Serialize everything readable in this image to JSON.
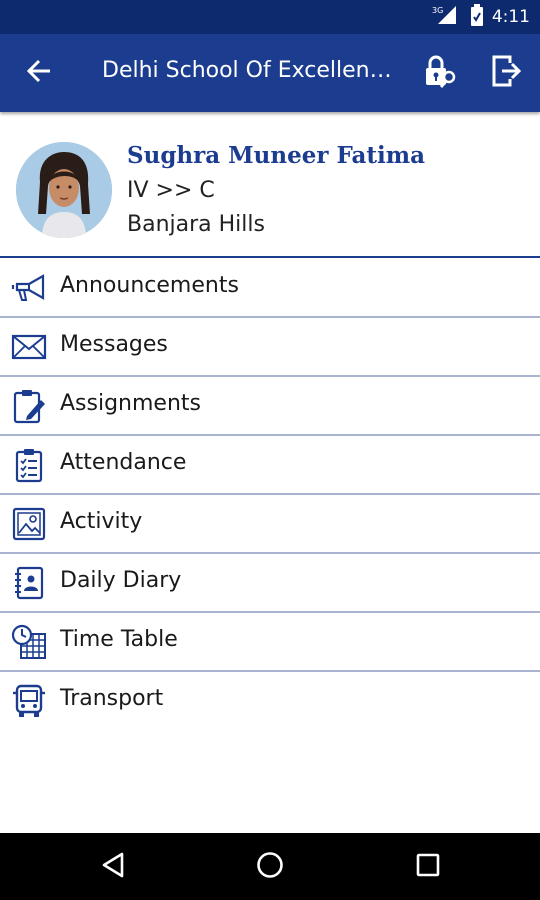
{
  "status_bar": {
    "network_label": "3G",
    "time": "4:11",
    "icons": [
      "signal-icon",
      "battery-icon"
    ]
  },
  "app_bar": {
    "title": "Delhi School Of Excellence",
    "back_icon": "back-arrow-icon",
    "lock_icon": "lock-key-icon",
    "logout_icon": "logout-icon",
    "background_color": "#1c3d8f"
  },
  "profile": {
    "name": "Sughra Muneer Fatima",
    "class_section": "IV >> C",
    "branch": "Banjara Hills"
  },
  "menu": {
    "items": [
      {
        "label": "Announcements",
        "icon": "megaphone-icon"
      },
      {
        "label": "Messages",
        "icon": "envelope-icon"
      },
      {
        "label": "Assignments",
        "icon": "clipboard-pencil-icon"
      },
      {
        "label": "Attendance",
        "icon": "checklist-icon"
      },
      {
        "label": "Activity",
        "icon": "image-icon"
      },
      {
        "label": "Daily Diary",
        "icon": "diary-icon"
      },
      {
        "label": "Time Table",
        "icon": "clock-calendar-icon"
      },
      {
        "label": "Transport",
        "icon": "bus-icon"
      }
    ]
  },
  "nav_bar": {
    "icons": [
      "back-triangle-icon",
      "home-circle-icon",
      "recents-square-icon"
    ]
  },
  "colors": {
    "primary": "#1c3d8f",
    "status_bar": "#0d2a6e",
    "divider": "#aab3d0"
  }
}
